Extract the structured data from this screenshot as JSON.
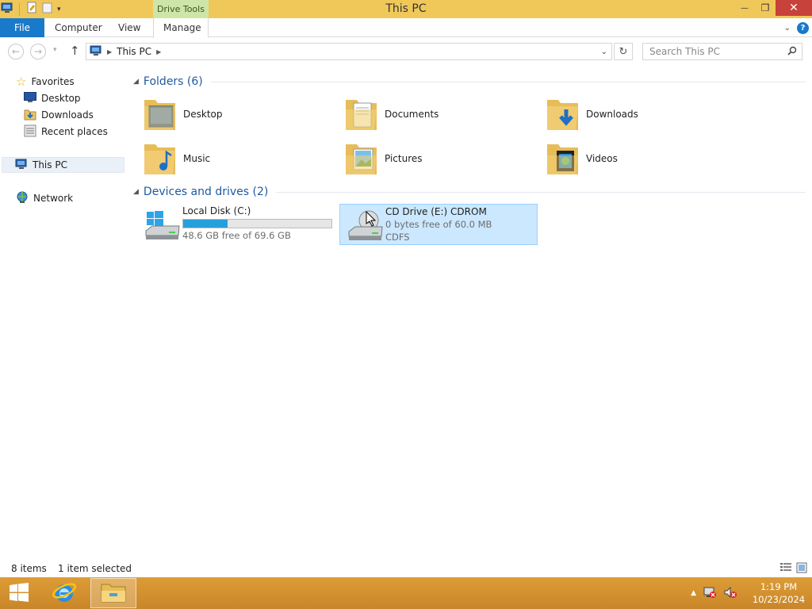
{
  "window": {
    "title": "This PC",
    "context_tab_group": "Drive Tools",
    "controls": {
      "minimize": "—",
      "restore": "❐",
      "close": "✕"
    }
  },
  "ribbon": {
    "tabs": [
      {
        "label": "File"
      },
      {
        "label": "Computer"
      },
      {
        "label": "View"
      },
      {
        "label": "Manage"
      }
    ],
    "help": "?"
  },
  "address": {
    "path": "This PC",
    "search_placeholder": "Search This PC"
  },
  "nav_pane": {
    "favorites": "Favorites",
    "favorite_items": [
      "Desktop",
      "Downloads",
      "Recent places"
    ],
    "this_pc": "This PC",
    "network": "Network"
  },
  "folders_group": {
    "title": "Folders (6)",
    "items": [
      "Desktop",
      "Documents",
      "Downloads",
      "Music",
      "Pictures",
      "Videos"
    ]
  },
  "drives_group": {
    "title": "Devices and drives (2)",
    "drives": [
      {
        "name": "Local Disk (C:)",
        "free_text": "48.6 GB free of 69.6 GB",
        "used_fraction": 0.3
      },
      {
        "name": "CD Drive (E:) CDROM",
        "free_text": "0 bytes free of 60.0 MB",
        "filesystem": "CDFS"
      }
    ]
  },
  "status": {
    "items": "8 items",
    "selected": "1 item selected"
  },
  "taskbar": {
    "time": "1:19 PM",
    "date": "10/23/2024"
  },
  "colors": {
    "titlebar": "#f0c85a",
    "accent": "#1979ca",
    "selection": "#cce8ff",
    "taskbar": "#d4912e"
  }
}
